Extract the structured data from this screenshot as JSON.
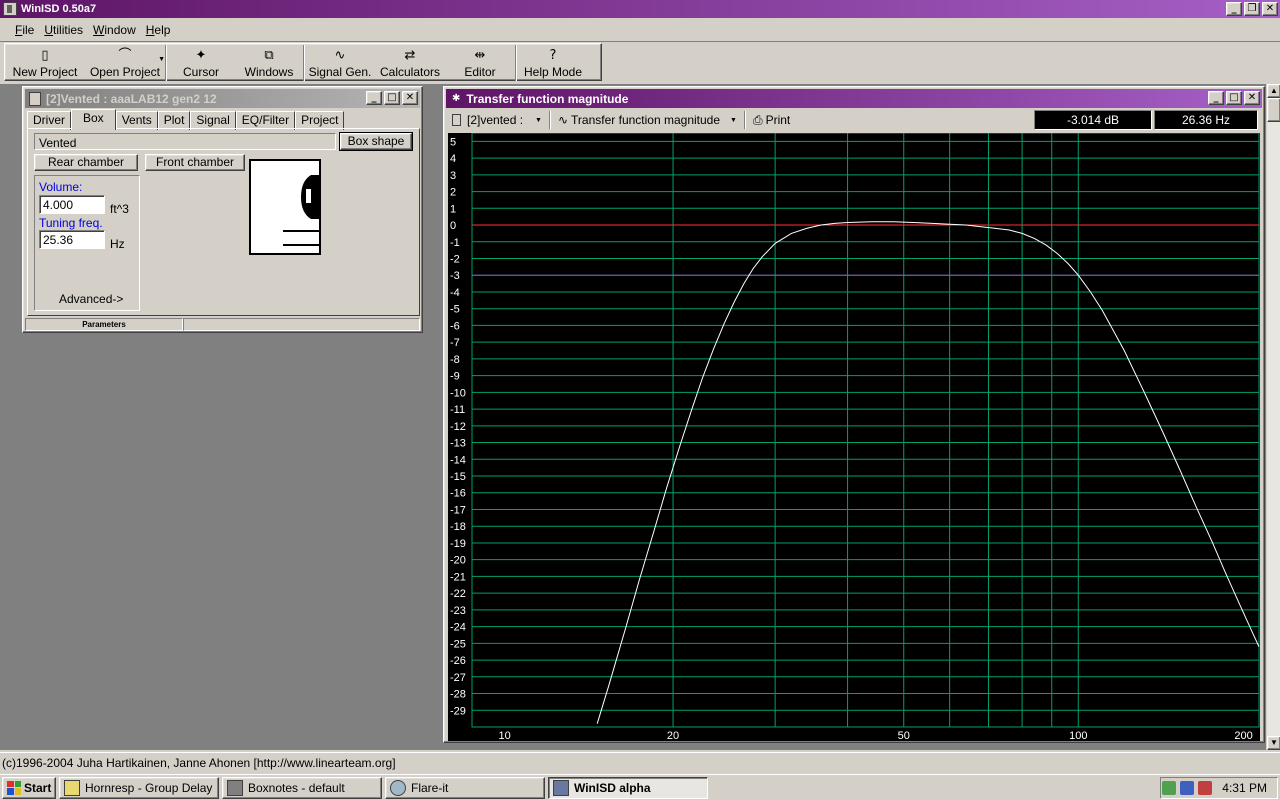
{
  "app": {
    "title": "WinISD 0.50a7"
  },
  "menu": [
    "File",
    "Utilities",
    "Window",
    "Help"
  ],
  "toolbar": [
    {
      "label": "New Project",
      "icon": "new-project-icon",
      "glyph": "▯"
    },
    {
      "label": "Open Project",
      "icon": "open-project-icon",
      "glyph": "⌒",
      "dropdown": true
    },
    {
      "label": "Cursor",
      "icon": "cursor-icon",
      "glyph": "✦"
    },
    {
      "label": "Windows",
      "icon": "windows-icon",
      "glyph": "⧉"
    },
    {
      "label": "Signal Gen.",
      "icon": "signal-gen-icon",
      "glyph": "∿"
    },
    {
      "label": "Calculators",
      "icon": "calculators-icon",
      "glyph": "⇄"
    },
    {
      "label": "Editor",
      "icon": "editor-icon",
      "glyph": "⇹"
    },
    {
      "label": "Help Mode",
      "icon": "help-mode-icon",
      "glyph": "?"
    }
  ],
  "box_window": {
    "title": "[2]Vented : aaaLAB12 gen2 12",
    "tabs": [
      "Driver",
      "Box",
      "Vents",
      "Plot",
      "Signal",
      "EQ/Filter",
      "Project"
    ],
    "selected_tab": "Box",
    "box_type": "Vented",
    "box_shape_label": "Box shape",
    "rear_chamber_label": "Rear chamber",
    "front_chamber_label": "Front chamber",
    "volume_label": "Volume:",
    "volume_value": "4.000",
    "volume_unit": "ft^3",
    "tuning_label": "Tuning freq.",
    "tuning_value": "25.36",
    "tuning_unit": "Hz",
    "advanced_label": "Advanced->",
    "status_label": "Parameters"
  },
  "tf_window": {
    "title": "Transfer function magnitude",
    "project_selector": "[2]vented :",
    "plot_selector": "Transfer function magnitude",
    "print_label": "Print",
    "cursor_db": "-3.014 dB",
    "cursor_hz": "26.36 Hz"
  },
  "chart_data": {
    "type": "line",
    "title": "",
    "xlabel": "",
    "ylabel": "",
    "xscale": "log",
    "xlim": [
      9,
      205
    ],
    "ylim": [
      -30,
      5.5
    ],
    "x_tick_labels": [
      10,
      20,
      50,
      100,
      200
    ],
    "x_gridlines": [
      20,
      30,
      40,
      50,
      60,
      70,
      80,
      90,
      100
    ],
    "y_tick_labels": [
      5,
      4,
      3,
      2,
      1,
      0,
      -1,
      -2,
      -3,
      -4,
      -5,
      -6,
      -7,
      -8,
      -9,
      -10,
      -11,
      -12,
      -13,
      -14,
      -15,
      -16,
      -17,
      -18,
      -19,
      -20,
      -21,
      -22,
      -23,
      -24,
      -25,
      -26,
      -27,
      -28,
      -29
    ],
    "reference_lines": [
      {
        "y": 0,
        "color": "#ff3030"
      },
      {
        "y": -3,
        "color": "#b040c0"
      }
    ],
    "grid": true,
    "grid_color": "#00a070",
    "series": [
      {
        "color": "#ffffff",
        "x": [
          14.8,
          15.5,
          16.5,
          17.5,
          18.5,
          19.5,
          20.5,
          21.5,
          22.5,
          23.5,
          24.5,
          25.5,
          26.5,
          27.5,
          28.5,
          30,
          32,
          34,
          36,
          38,
          40,
          44,
          48,
          52,
          56,
          60,
          64,
          68,
          72,
          76,
          80,
          84,
          88,
          92,
          96,
          100,
          105,
          110,
          120,
          130,
          140,
          150,
          160,
          170,
          180,
          190,
          200,
          205
        ],
        "y": [
          -29.8,
          -27.5,
          -24.3,
          -21.2,
          -18.4,
          -15.7,
          -13.3,
          -11.1,
          -9.1,
          -7.4,
          -5.9,
          -4.6,
          -3.5,
          -2.6,
          -1.9,
          -1.1,
          -0.5,
          -0.2,
          0.0,
          0.1,
          0.15,
          0.2,
          0.2,
          0.15,
          0.1,
          0.05,
          0.0,
          -0.1,
          -0.2,
          -0.3,
          -0.5,
          -0.8,
          -1.2,
          -1.7,
          -2.3,
          -3.0,
          -4.0,
          -5.1,
          -7.5,
          -10.0,
          -12.4,
          -14.7,
          -16.9,
          -18.9,
          -20.9,
          -22.7,
          -24.4,
          -25.2
        ]
      }
    ]
  },
  "status_bar": "(c)1996-2004 Juha Hartikainen, Janne Ahonen [http://www.linearteam.org]",
  "taskbar": {
    "start_label": "Start",
    "tasks": [
      {
        "label": "Hornresp - Group Delay",
        "icon": "hornresp-icon",
        "active": false
      },
      {
        "label": "Boxnotes - default",
        "icon": "boxnotes-icon",
        "active": false
      },
      {
        "label": "Flare-it",
        "icon": "flareit-icon",
        "active": false
      },
      {
        "label": "WinISD alpha",
        "icon": "winisd-icon",
        "active": true
      }
    ],
    "clock": "4:31 PM"
  }
}
